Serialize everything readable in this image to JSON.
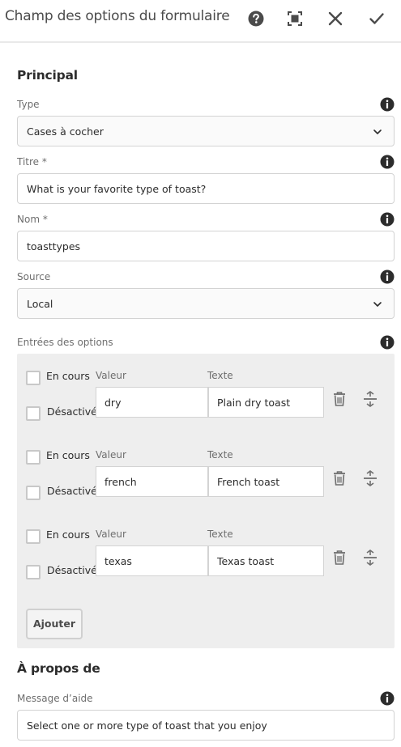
{
  "header": {
    "title": "Champ des options du formulaire",
    "icons": [
      "help-icon",
      "fullscreen-icon",
      "close-icon",
      "checkmark-icon"
    ]
  },
  "main": {
    "heading": "Principal",
    "type": {
      "label": "Type",
      "value": "Cases à cocher"
    },
    "titre": {
      "label": "Titre *",
      "value": "What is your favorite type of toast?"
    },
    "nom": {
      "label": "Nom *",
      "value": "toasttypes"
    },
    "source": {
      "label": "Source",
      "value": "Local"
    },
    "options": {
      "label": "Entrées des options",
      "current_label": "En cours",
      "disabled_label": "Désactivé",
      "value_header": "Valeur",
      "text_header": "Texte",
      "items": [
        {
          "value": "dry",
          "text": "Plain dry toast"
        },
        {
          "value": "french",
          "text": "French toast"
        },
        {
          "value": "texas",
          "text": "Texas toast"
        }
      ],
      "add_label": "Ajouter"
    }
  },
  "about": {
    "heading": "À propos de",
    "help_message": {
      "label": "Message d’aide",
      "value": "Select one or more type of toast that you enjoy"
    }
  },
  "colors": {
    "icon": "#4b4b4b",
    "border": "#d3d3d3",
    "multifield_bg": "#eeeeee"
  }
}
